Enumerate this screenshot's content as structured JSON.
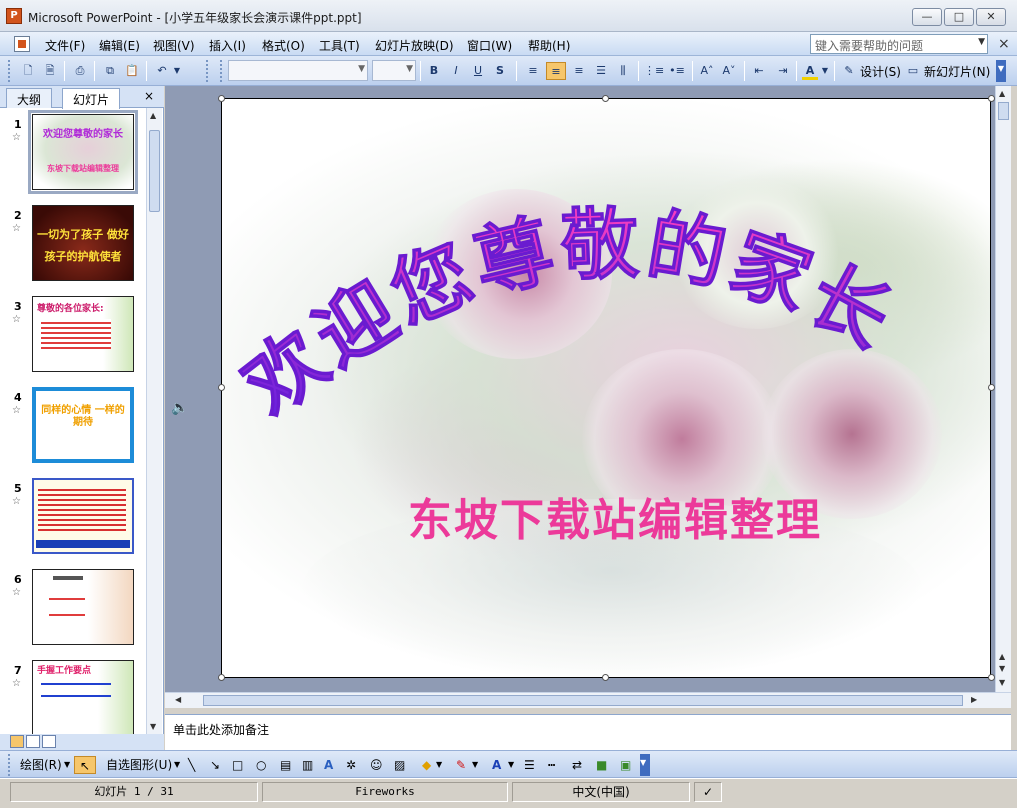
{
  "window": {
    "title": "Microsoft PowerPoint - [小学五年级家长会演示课件ppt.ppt]",
    "app_icon_label": "P",
    "minimize_label": "—",
    "maximize_label": "□",
    "close_label": "✕"
  },
  "menu": {
    "items": [
      "文件(F)",
      "编辑(E)",
      "视图(V)",
      "插入(I)",
      "格式(O)",
      "工具(T)",
      "幻灯片放映(D)",
      "窗口(W)",
      "帮助(H)"
    ],
    "help_placeholder": "键入需要帮助的问题",
    "close_doc_label": "×"
  },
  "toolbar": {
    "undo_label": "↶",
    "font_name": "",
    "font_size": "",
    "bold": "B",
    "italic": "I",
    "underline": "U",
    "shadow": "S",
    "design_label": "设计(S)",
    "new_slide_label": "新幻灯片(N)",
    "font_color_label": "A"
  },
  "left_panel": {
    "tab_outline": "大纲",
    "tab_slides": "幻灯片",
    "close_label": "×",
    "star": "☆",
    "thumbnails": [
      {
        "num": "1",
        "text": "东坡下载站编辑整理",
        "selected": true
      },
      {
        "num": "2",
        "text": "一切为了孩子 做好孩子的护航使者"
      },
      {
        "num": "3",
        "text": "尊敬的各位家长:"
      },
      {
        "num": "4",
        "text": "同样的心情 一样的期待"
      },
      {
        "num": "5",
        "text": ""
      },
      {
        "num": "6",
        "text": ""
      },
      {
        "num": "7",
        "text": "手握工作要点"
      }
    ]
  },
  "slide": {
    "title": "欢迎您尊敬的家长",
    "subtitle": "东坡下载站编辑整理",
    "title_color_start": "#ff3fbf",
    "title_color_end": "#5a1ee0",
    "subtitle_color": "#ec3a9a"
  },
  "notes": {
    "placeholder": "单击此处添加备注"
  },
  "drawbar": {
    "draw_label": "绘图(R)",
    "autoshape_label": "自选图形(U)"
  },
  "status": {
    "slide_pos": "幻灯片 1 / 31",
    "design": "Fireworks",
    "language": "中文(中国)"
  }
}
